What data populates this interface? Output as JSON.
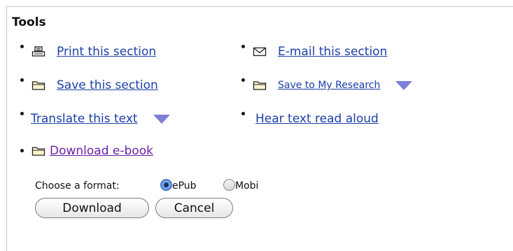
{
  "tools": {
    "title": "Tools",
    "items": [
      {
        "label": "Print this section",
        "icon": "printer-icon"
      },
      {
        "label": "E-mail this section",
        "icon": "envelope-icon"
      },
      {
        "label": "Save this section",
        "icon": "folder-icon"
      },
      {
        "label": "Save to My Research",
        "icon": "folder-icon",
        "has_dropdown": true
      },
      {
        "label": "Translate this text",
        "has_dropdown": true
      },
      {
        "label": "Hear text read aloud"
      },
      {
        "label": "Download e-book",
        "icon": "folder-icon"
      }
    ]
  },
  "download_form": {
    "format_label": "Choose a format:",
    "options": [
      {
        "label": "ePub",
        "selected": true
      },
      {
        "label": "Mobi",
        "selected": false
      }
    ],
    "download_button": "Download",
    "cancel_button": "Cancel"
  },
  "colors": {
    "link": "#1a3fa6",
    "visited_link": "#6a1fa3",
    "dropdown_arrow": "#7b7fd8"
  }
}
